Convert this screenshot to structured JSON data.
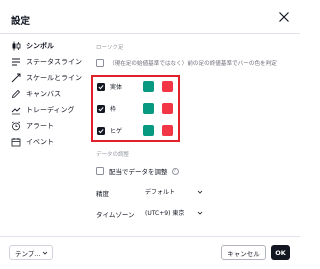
{
  "dialog": {
    "title": "設定"
  },
  "sidebar": {
    "items": [
      {
        "label": "シンボル",
        "icon": "candles-icon",
        "active": true
      },
      {
        "label": "ステータスライン",
        "icon": "status-line-icon",
        "active": false
      },
      {
        "label": "スケールとライン",
        "icon": "scales-icon",
        "active": false
      },
      {
        "label": "キャンバス",
        "icon": "pen-icon",
        "active": false
      },
      {
        "label": "トレーディング",
        "icon": "trading-icon",
        "active": false
      },
      {
        "label": "アラート",
        "icon": "alarm-clock-icon",
        "active": false
      },
      {
        "label": "イベント",
        "icon": "calendar-icon",
        "active": false
      }
    ]
  },
  "main": {
    "candles_section_label": "ローソク足",
    "color_bars_option": "（現在足の始値基準ではなく）前の足の終値基準でバーの色を判定",
    "rows": [
      {
        "label": "実体",
        "checked": true,
        "up_color": "#089981",
        "down_color": "#f23645"
      },
      {
        "label": "枠",
        "checked": true,
        "up_color": "#089981",
        "down_color": "#f23645"
      },
      {
        "label": "ヒゲ",
        "checked": true,
        "up_color": "#089981",
        "down_color": "#f23645"
      }
    ],
    "data_section_label": "データの調整",
    "adjust_dividends_label": "配当でデータを調整",
    "precision_label": "精度",
    "precision_value": "デフォルト",
    "timezone_label": "タイムゾーン",
    "timezone_value": "(UTC+9) 東京"
  },
  "footer": {
    "template_label": "テンプ...",
    "cancel_label": "キャンセル",
    "ok_label": "OK"
  },
  "colors": {
    "highlight_border": "#e0202a",
    "ok_background": "#131722"
  }
}
